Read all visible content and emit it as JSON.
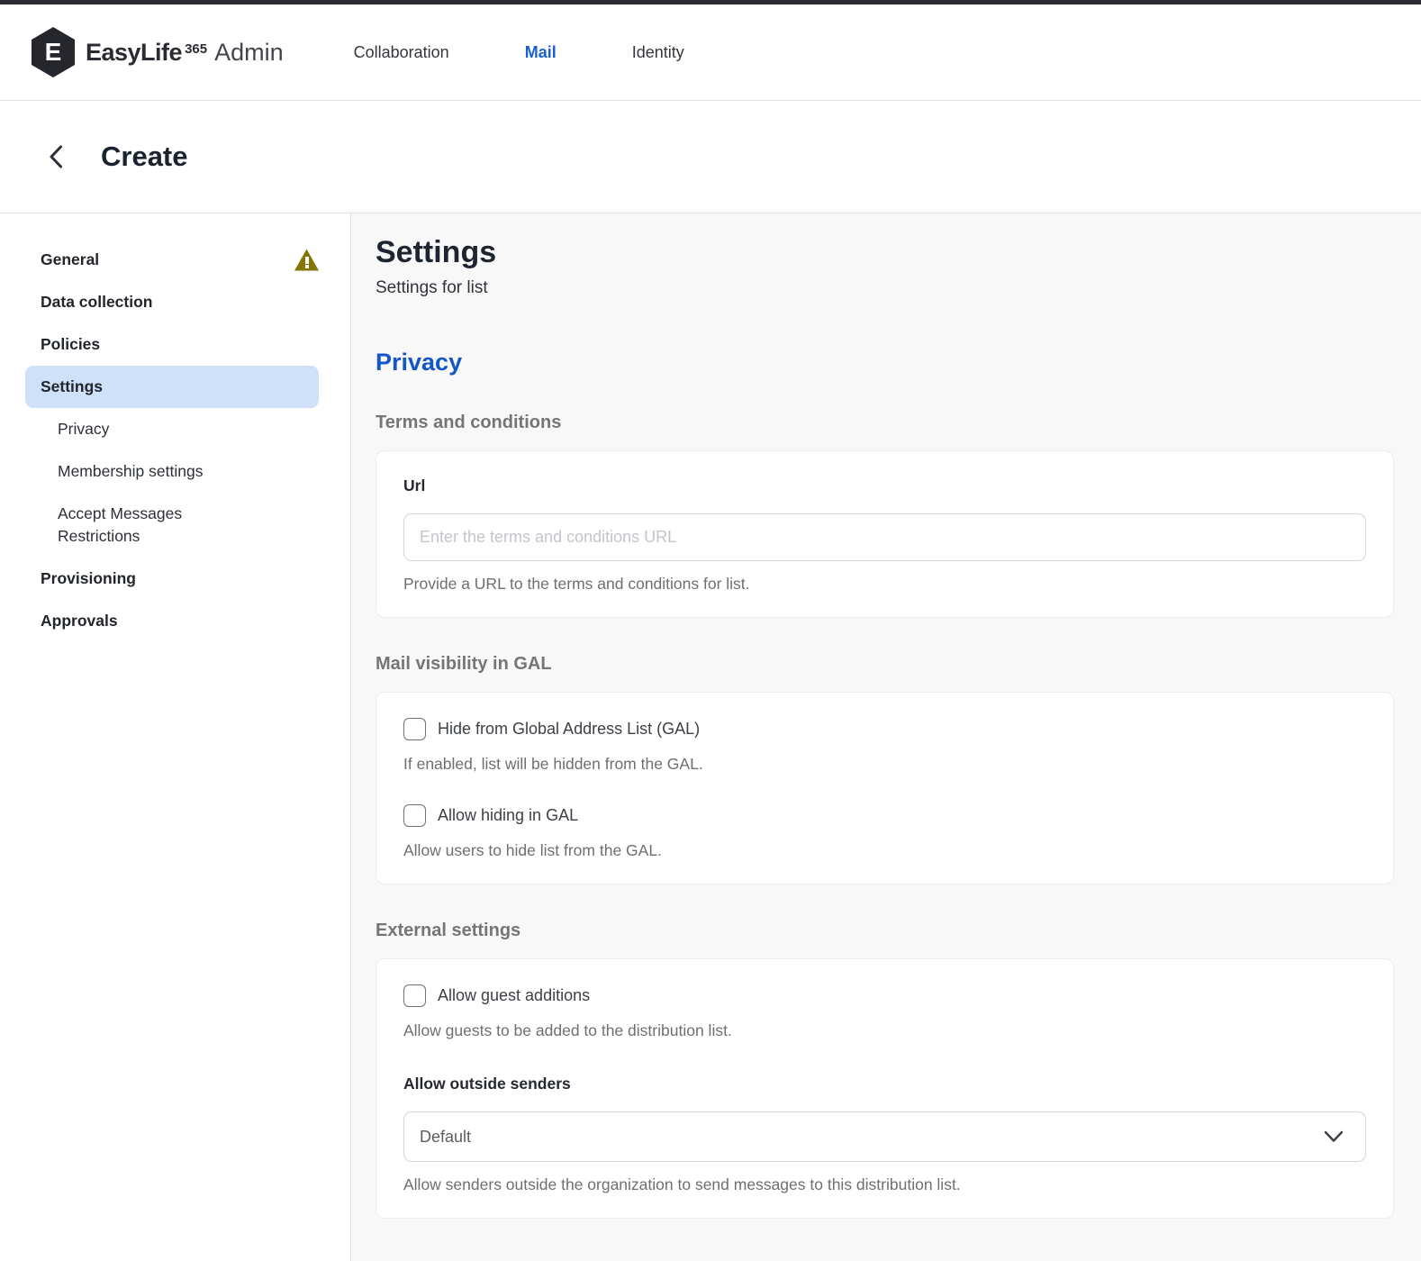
{
  "header": {
    "logo": {
      "mark_letter": "E",
      "brand": "EasyLife",
      "superscript": "365",
      "suffix": "Admin"
    },
    "nav": [
      {
        "label": "Collaboration",
        "active": false
      },
      {
        "label": "Mail",
        "active": true
      },
      {
        "label": "Identity",
        "active": false
      }
    ]
  },
  "create_bar": {
    "title": "Create"
  },
  "sidebar": {
    "items": [
      {
        "label": "General",
        "warning": true
      },
      {
        "label": "Data collection"
      },
      {
        "label": "Policies"
      },
      {
        "label": "Settings",
        "active": true
      },
      {
        "label": "Privacy",
        "sub": true
      },
      {
        "label": "Membership settings",
        "sub": true
      },
      {
        "label": "Accept Messages Restrictions",
        "sub": true
      },
      {
        "label": "Provisioning"
      },
      {
        "label": "Approvals"
      }
    ]
  },
  "main": {
    "title": "Settings",
    "subtitle": "Settings for list",
    "section_title": "Privacy",
    "terms": {
      "heading": "Terms and conditions",
      "url_label": "Url",
      "url_value": "",
      "url_placeholder": "Enter the terms and conditions URL",
      "helper": "Provide a URL to the terms and conditions for list."
    },
    "gal": {
      "heading": "Mail visibility in GAL",
      "checkboxes": [
        {
          "label": "Hide from Global Address List (GAL)",
          "checked": false,
          "helper": "If enabled, list will be hidden from the GAL."
        },
        {
          "label": "Allow hiding in GAL",
          "checked": false,
          "helper": "Allow users to hide list from the GAL."
        }
      ]
    },
    "external": {
      "heading": "External settings",
      "guest_checkbox": {
        "label": "Allow guest additions",
        "checked": false,
        "helper": "Allow guests to be added to the distribution list."
      },
      "outside_senders": {
        "label": "Allow outside senders",
        "value": "Default",
        "helper": "Allow senders outside the organization to send messages to this distribution list."
      }
    }
  },
  "colors": {
    "accent_blue": "#1a5fd1",
    "active_item_bg": "#cfe0f9",
    "warning_olive": "#857502",
    "top_strip": "#2a2b33",
    "main_bg": "#f8f8f9"
  }
}
